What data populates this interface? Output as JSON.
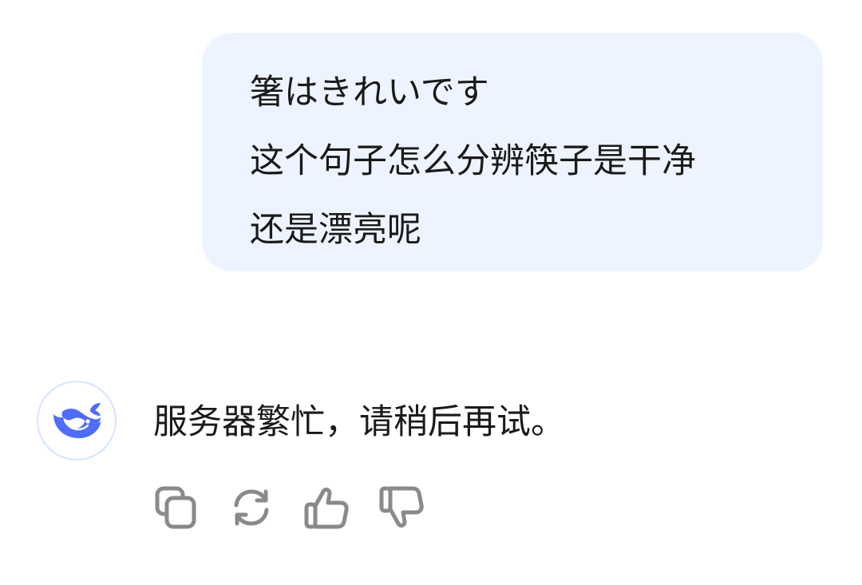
{
  "conversation": {
    "user_message": {
      "lines": [
        "箸はきれいです",
        "这个句子怎么分辨筷子是干净",
        "还是漂亮呢"
      ]
    },
    "assistant_message": {
      "avatar_icon": "deepseek-whale-icon",
      "text": "服务器繁忙，请稍后再试。"
    },
    "actions": [
      {
        "name": "copy",
        "icon": "copy-icon"
      },
      {
        "name": "regenerate",
        "icon": "refresh-icon"
      },
      {
        "name": "like",
        "icon": "thumbs-up-icon"
      },
      {
        "name": "dislike",
        "icon": "thumbs-down-icon"
      }
    ]
  },
  "colors": {
    "user_bubble_bg": "#eef4ff",
    "brand_blue": "#4d6bfe",
    "icon_gray": "#8a8a8a",
    "text": "#1a1a1a"
  }
}
